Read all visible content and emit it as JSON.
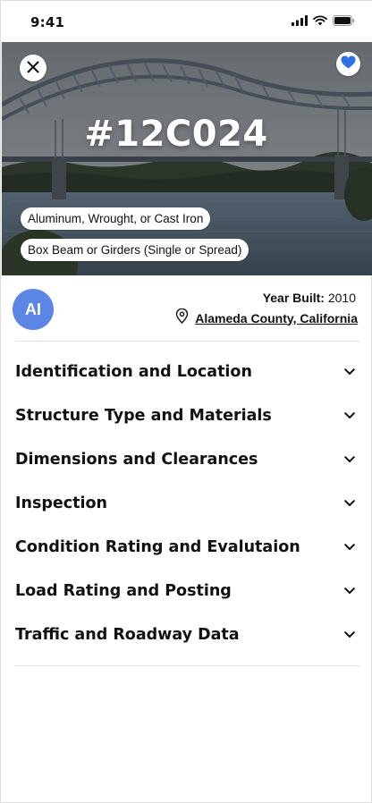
{
  "status_bar": {
    "time": "9:41",
    "icons": [
      "signal-icon",
      "wifi-icon",
      "battery-icon"
    ]
  },
  "hero": {
    "title": "#12C024",
    "close_icon": "close-icon",
    "favorite_icon": "heart-icon",
    "favorite_color": "#2f6fe8",
    "tags": [
      "Aluminum, Wrought, or Cast Iron",
      "Box Beam or Girders (Single or Spread)"
    ]
  },
  "info": {
    "avatar_label": "AI",
    "avatar_color": "#5b86e5",
    "year_built_label": "Year Built:",
    "year_built_value": "2010",
    "location_icon": "map-pin-icon",
    "location": "Alameda County, California"
  },
  "sections": [
    {
      "label": "Identification and Location"
    },
    {
      "label": "Structure Type and Materials"
    },
    {
      "label": "Dimensions and Clearances"
    },
    {
      "label": "Inspection"
    },
    {
      "label": "Condition Rating and Evalutaion"
    },
    {
      "label": "Load Rating and Posting"
    },
    {
      "label": "Traffic and Roadway Data"
    }
  ]
}
